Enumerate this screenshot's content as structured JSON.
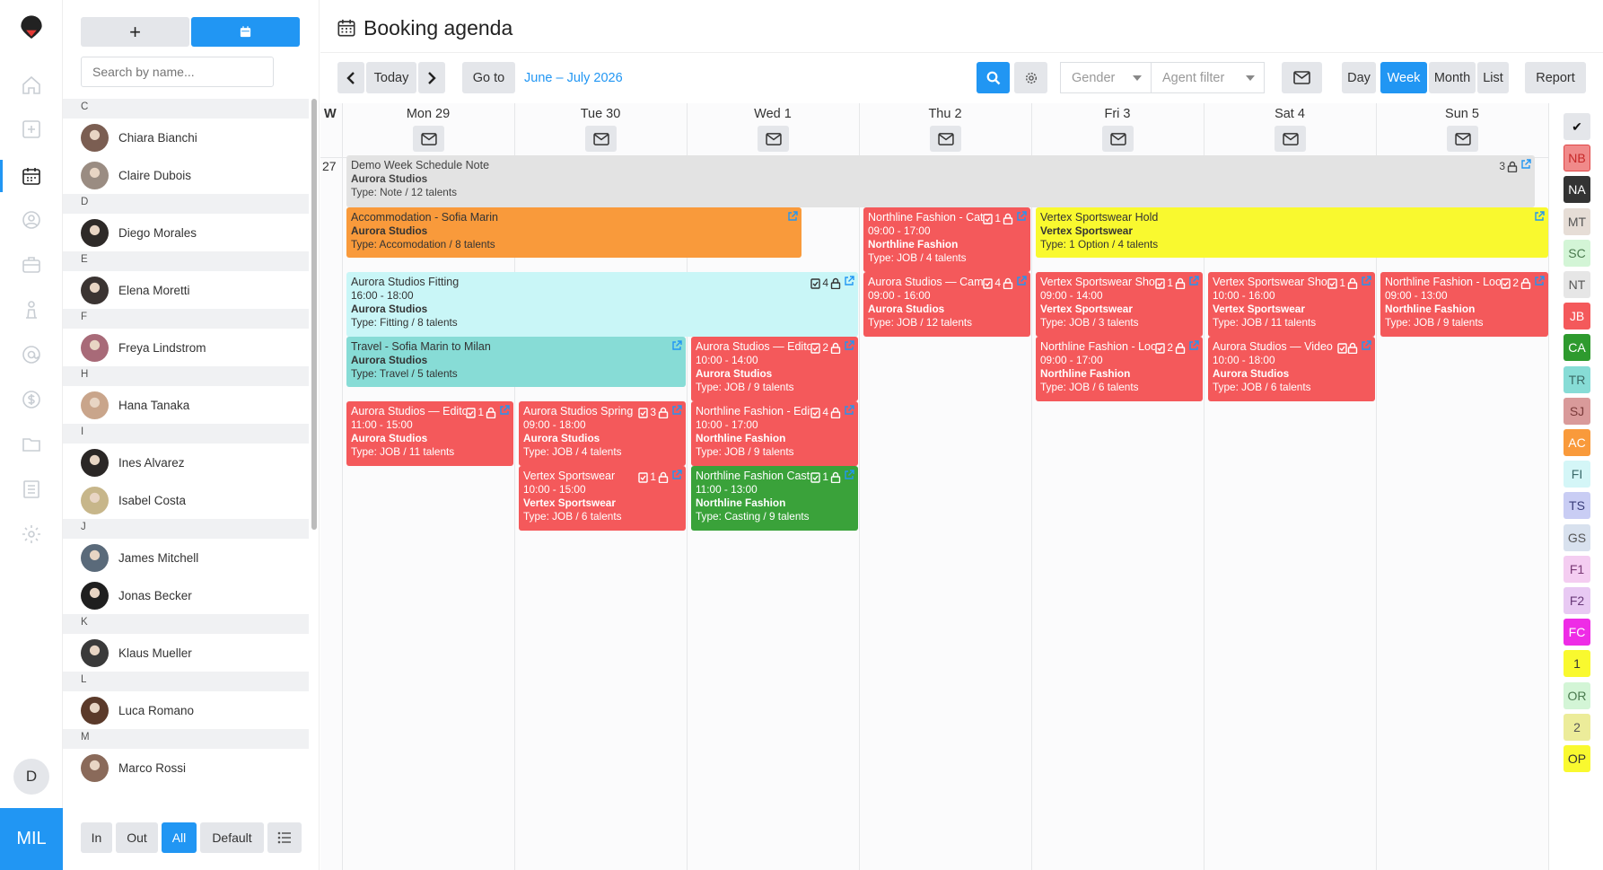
{
  "rail": {
    "workspace": "MIL",
    "user_initial": "D",
    "icons": [
      "logo-icon",
      "home-icon",
      "add-icon",
      "calendar-icon",
      "user-icon",
      "briefcase-icon",
      "model-icon",
      "at-icon",
      "dollar-icon",
      "folder-icon",
      "list-icon",
      "settings-icon"
    ]
  },
  "sidebar": {
    "search_placeholder": "Search by name...",
    "add_label": "+",
    "groups": [
      {
        "letter": "C",
        "names": [
          "Chiara Bianchi",
          "Claire Dubois"
        ]
      },
      {
        "letter": "D",
        "names": [
          "Diego Morales"
        ]
      },
      {
        "letter": "E",
        "names": [
          "Elena Moretti"
        ]
      },
      {
        "letter": "F",
        "names": [
          "Freya Lindstrom"
        ]
      },
      {
        "letter": "H",
        "names": [
          "Hana Tanaka"
        ]
      },
      {
        "letter": "I",
        "names": [
          "Ines Alvarez",
          "Isabel Costa"
        ]
      },
      {
        "letter": "J",
        "names": [
          "James Mitchell",
          "Jonas Becker"
        ]
      },
      {
        "letter": "K",
        "names": [
          "Klaus Mueller"
        ]
      },
      {
        "letter": "L",
        "names": [
          "Luca Romano"
        ]
      },
      {
        "letter": "M",
        "names": [
          "Marco Rossi"
        ]
      }
    ],
    "filters": {
      "in": "In",
      "out": "Out",
      "all": "All",
      "default": "Default"
    }
  },
  "header": {
    "title": "Booking agenda"
  },
  "toolbar": {
    "today": "Today",
    "goto": "Go to",
    "range": "June – July 2026",
    "gender_placeholder": "Gender",
    "agent_placeholder": "Agent filter",
    "views": [
      "Day",
      "Week",
      "Month",
      "List"
    ],
    "active_view": "Week",
    "report": "Report"
  },
  "calendar": {
    "week_label": "W",
    "week_number": "27",
    "days": [
      "Mon 29",
      "Tue 30",
      "Wed 1",
      "Thu 2",
      "Fri 3",
      "Sat 4",
      "Sun 5"
    ],
    "events": [
      {
        "title": "Demo Week Schedule Note",
        "time": "",
        "client": "Aurora Studios",
        "type": "Type: Note / 12 talents",
        "count": "3"
      },
      {
        "title": "Accommodation - Sofia Marin",
        "time": "",
        "client": "Aurora Studios",
        "type": "Type: Accomodation / 8 talents",
        "count": ""
      },
      {
        "title": "Northline Fashion - Catalog",
        "time": "09:00 - 17:00",
        "client": "Northline Fashion",
        "type": "Type: JOB / 4 talents",
        "count": "1"
      },
      {
        "title": "Vertex Sportswear Hold",
        "time": "",
        "client": "Vertex Sportswear",
        "type": "Type: 1 Option / 4 talents",
        "count": ""
      },
      {
        "title": "Aurora Studios Fitting",
        "time": "16:00 - 18:00",
        "client": "Aurora Studios",
        "type": "Type: Fitting / 8 talents",
        "count": "4"
      },
      {
        "title": "Aurora Studios — Campaign",
        "time": "09:00 - 16:00",
        "client": "Aurora Studios",
        "type": "Type: JOB / 12 talents",
        "count": "4"
      },
      {
        "title": "Vertex Sportswear Shoot",
        "time": "09:00 - 14:00",
        "client": "Vertex Sportswear",
        "type": "Type: JOB / 3 talents",
        "count": "1"
      },
      {
        "title": "Vertex Sportswear Shoot",
        "time": "10:00 - 16:00",
        "client": "Vertex Sportswear",
        "type": "Type: JOB / 11 talents",
        "count": "1"
      },
      {
        "title": "Northline Fashion - Lookbook",
        "time": "09:00 - 13:00",
        "client": "Northline Fashion",
        "type": "Type: JOB / 9 talents",
        "count": "2"
      },
      {
        "title": "Travel - Sofia Marin to Milan",
        "time": "",
        "client": "Aurora Studios",
        "type": "Type: Travel / 5 talents",
        "count": ""
      },
      {
        "title": "Aurora Studios — Editorial",
        "time": "10:00 - 14:00",
        "client": "Aurora Studios",
        "type": "Type: JOB / 9 talents",
        "count": "2"
      },
      {
        "title": "Northline Fashion - Lookbook",
        "time": "09:00 - 17:00",
        "client": "Northline Fashion",
        "type": "Type: JOB / 6 talents",
        "count": "2"
      },
      {
        "title": "Aurora Studios — Video",
        "time": "10:00 - 18:00",
        "client": "Aurora Studios",
        "type": "Type: JOB / 6 talents",
        "count": ""
      },
      {
        "title": "Aurora Studios — Editorial",
        "time": "11:00 - 15:00",
        "client": "Aurora Studios",
        "type": "Type: JOB / 11 talents",
        "count": "1"
      },
      {
        "title": "Aurora Studios Spring",
        "time": "09:00 - 18:00",
        "client": "Aurora Studios",
        "type": "Type: JOB / 4 talents",
        "count": "3"
      },
      {
        "title": "Northline Fashion - Editorial",
        "time": "10:00 - 17:00",
        "client": "Northline Fashion",
        "type": "Type: JOB / 9 talents",
        "count": "4"
      },
      {
        "title": "Vertex Sportswear",
        "time": "10:00 - 15:00",
        "client": "Vertex Sportswear",
        "type": "Type: JOB / 6 talents",
        "count": "1"
      },
      {
        "title": "Northline Fashion Casting",
        "time": "11:00 - 13:00",
        "client": "Northline Fashion",
        "type": "Type: Casting / 9 talents",
        "count": "1"
      }
    ]
  },
  "tags": [
    {
      "label": "✔",
      "bg": "#e4e6ea",
      "fg": "#111"
    },
    {
      "label": "NB",
      "bg": "#f08a8a",
      "fg": "#c62828"
    },
    {
      "label": "NA",
      "bg": "#333333",
      "fg": "#ffffff"
    },
    {
      "label": "MT",
      "bg": "#e6ddd6",
      "fg": "#555"
    },
    {
      "label": "SC",
      "bg": "#d3f5d6",
      "fg": "#4a7a4e"
    },
    {
      "label": "NT",
      "bg": "#e6e6e6",
      "fg": "#555"
    },
    {
      "label": "JB",
      "bg": "#f4595b",
      "fg": "#ffffff"
    },
    {
      "label": "CA",
      "bg": "#2e9a2e",
      "fg": "#ffffff"
    },
    {
      "label": "TR",
      "bg": "#87dcd6",
      "fg": "#3a6a66"
    },
    {
      "label": "SJ",
      "bg": "#d99a9a",
      "fg": "#7a3a3a"
    },
    {
      "label": "AC",
      "bg": "#f99a3b",
      "fg": "#ffffff"
    },
    {
      "label": "FI",
      "bg": "#d4f6f7",
      "fg": "#3a6a6a"
    },
    {
      "label": "TS",
      "bg": "#c9cdf4",
      "fg": "#3a3e7a"
    },
    {
      "label": "GS",
      "bg": "#d8e1ee",
      "fg": "#555"
    },
    {
      "label": "F1",
      "bg": "#f4cdf1",
      "fg": "#7a3a76"
    },
    {
      "label": "F2",
      "bg": "#e8c9f3",
      "fg": "#6a3a7a"
    },
    {
      "label": "FC",
      "bg": "#ee2ce6",
      "fg": "#ffffff"
    },
    {
      "label": "1",
      "bg": "#f9f92f",
      "fg": "#333"
    },
    {
      "label": "OR",
      "bg": "#d3f5d6",
      "fg": "#4a7a4e"
    },
    {
      "label": "2",
      "bg": "#ecec9a",
      "fg": "#555"
    },
    {
      "label": "OP",
      "bg": "#f9f92f",
      "fg": "#333"
    }
  ]
}
